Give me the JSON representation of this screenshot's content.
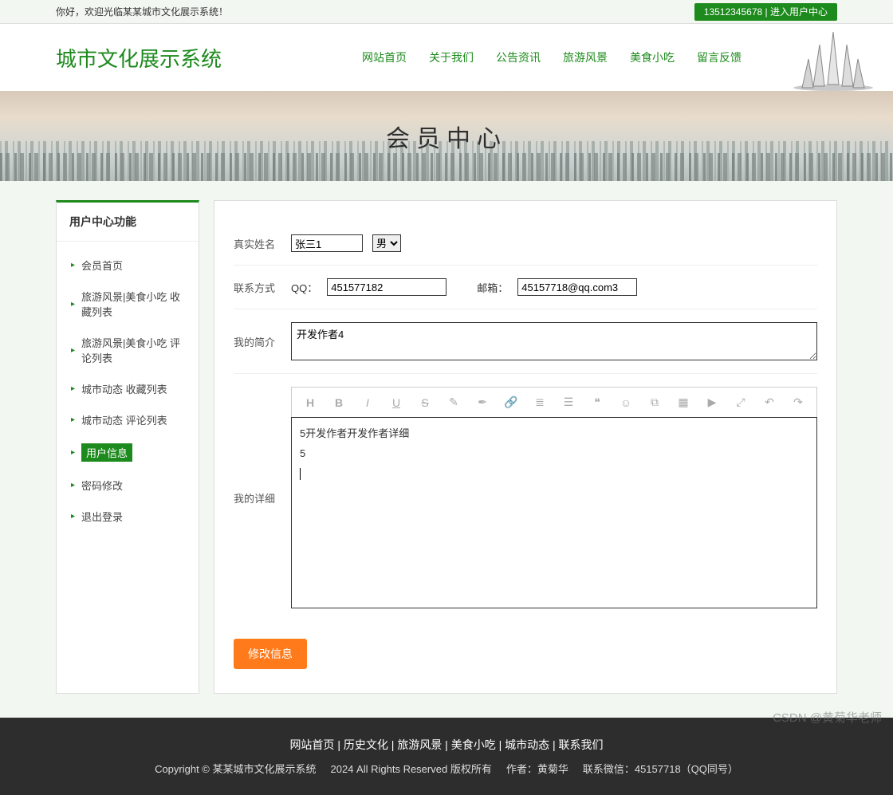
{
  "topbar": {
    "welcome": "你好，欢迎光临某某城市文化展示系统！",
    "phone": "13512345678",
    "sep": " | ",
    "enter": "进入用户中心"
  },
  "site_title": "城市文化展示系统",
  "nav": {
    "items": [
      {
        "label": "网站首页"
      },
      {
        "label": "关于我们"
      },
      {
        "label": "公告资讯"
      },
      {
        "label": "旅游风景"
      },
      {
        "label": "美食小吃"
      },
      {
        "label": "留言反馈"
      }
    ]
  },
  "banner_title": "会员中心",
  "sidebar": {
    "title": "用户中心功能",
    "items": [
      {
        "label": "会员首页"
      },
      {
        "label": "旅游风景|美食小吃 收藏列表"
      },
      {
        "label": "旅游风景|美食小吃 评论列表"
      },
      {
        "label": "城市动态 收藏列表"
      },
      {
        "label": "城市动态 评论列表"
      },
      {
        "label": "用户信息",
        "active": true
      },
      {
        "label": "密码修改"
      },
      {
        "label": "退出登录"
      }
    ]
  },
  "formLabels": {
    "realname": "真实姓名",
    "contact": "联系方式",
    "qq": "QQ：",
    "email": "邮箱：",
    "intro": "我的简介",
    "detail": "我的详细"
  },
  "form": {
    "name_value": "张三1",
    "gender_value": "男",
    "qq_value": "451577182",
    "email_value": "45157718@qq.com3",
    "intro_value": "开发作者4",
    "detail_line1": "5开发作者开发作者详细",
    "detail_line2": "5",
    "submit_label": "修改信息"
  },
  "editor_icons": {
    "h": "H",
    "b": "B",
    "i": "I",
    "u": "U",
    "s": "S",
    "erase": "✎",
    "paint": "✒",
    "link": "🔗",
    "ul": "≣",
    "indent": "☰",
    "quote": "❝",
    "emoji": "☺",
    "img": "⧉",
    "table": "▦",
    "video": "▶",
    "expand": "⤢",
    "undo": "↶",
    "redo": "↷"
  },
  "footer": {
    "links": [
      {
        "label": "网站首页"
      },
      {
        "label": "历史文化"
      },
      {
        "label": "旅游风景"
      },
      {
        "label": "美食小吃"
      },
      {
        "label": "城市动态"
      },
      {
        "label": "联系我们"
      }
    ],
    "link_sep": " | ",
    "copyright": "Copyright © 某某城市文化展示系统",
    "rights": "2024 All Rights Reserved 版权所有",
    "author_label": "作者：黄菊华",
    "wechat_label": "联系微信：45157718（QQ同号）"
  },
  "watermark": "CSDN @黄菊华老师"
}
